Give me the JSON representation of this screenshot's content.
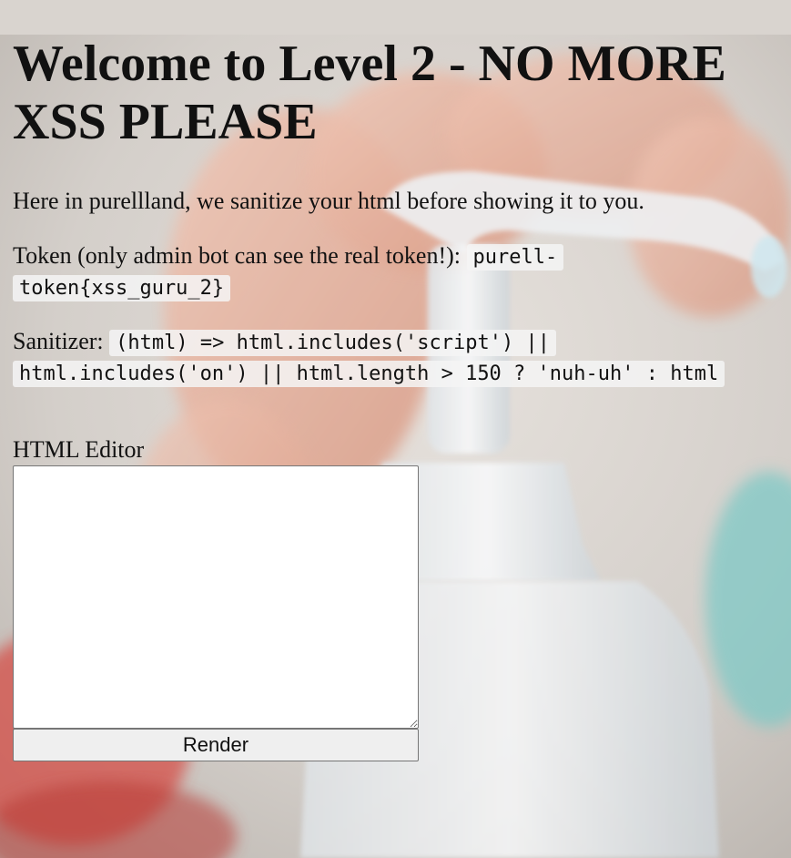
{
  "heading": "Welcome to Level 2 - NO MORE XSS PLEASE",
  "intro": "Here in purellland, we sanitize your html before showing it to you.",
  "token": {
    "label": "Token (only admin bot can see the real token!): ",
    "value": "purell-token{xss_guru_2}"
  },
  "sanitizer": {
    "label": "Sanitizer: ",
    "code": "(html) => html.includes('script') || html.includes('on') || html.length > 150 ? 'nuh-uh' : html"
  },
  "editor": {
    "label": "HTML Editor",
    "value": "",
    "render_label": "Render"
  },
  "background": {
    "description_icon": "hand-sanitizer-photo",
    "colors": {
      "skin": "#e7b29e",
      "bottle": "#f2f4f6",
      "teal": "#7fc9c6",
      "red": "#d7463f"
    }
  }
}
